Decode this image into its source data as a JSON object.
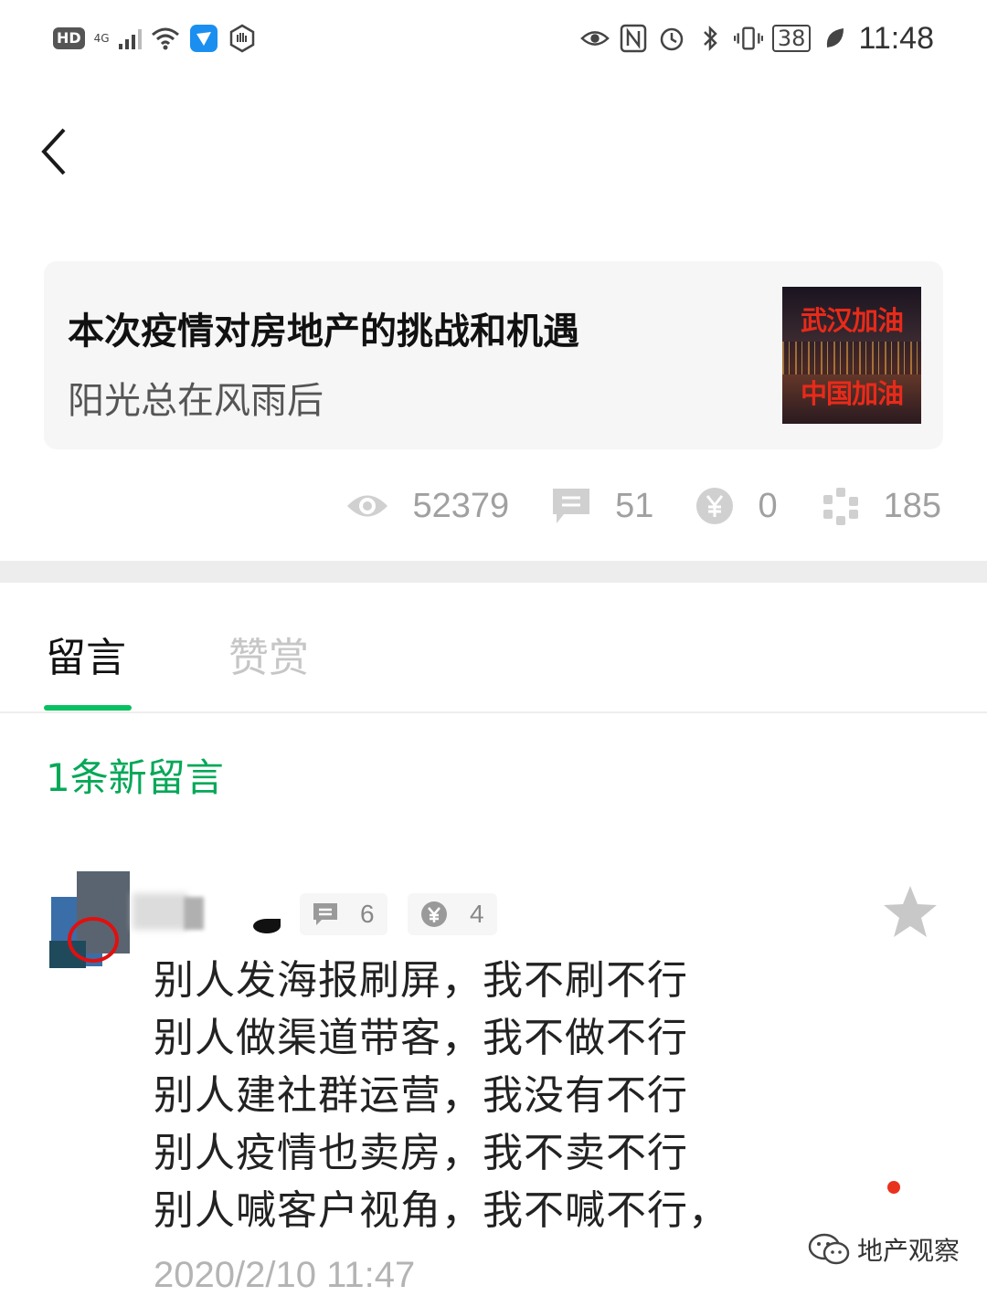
{
  "status_bar": {
    "left_badge": "HD",
    "network": "4G",
    "battery": "38",
    "time": "11:48"
  },
  "article": {
    "title": "本次疫情对房地产的挑战和机遇",
    "author": "阳光总在风雨后",
    "thumbnail_text_top": "武汉加油",
    "thumbnail_text_bottom": "中国加油"
  },
  "stats": {
    "views": "52379",
    "comments": "51",
    "rewards": "0",
    "shares": "185"
  },
  "tabs": [
    {
      "label": "留言",
      "active": true
    },
    {
      "label": "赞赏",
      "active": false
    }
  ],
  "colors": {
    "accent": "#07c160",
    "new_comment_text": "#06a858",
    "dot": "#e8321e"
  },
  "new_comments_label": "1条新留言",
  "comment": {
    "reply_count": "6",
    "like_count": "4",
    "lines": [
      "别人发海报刷屏，我不刷不行",
      "别人做渠道带客，我不做不行",
      "别人建社群运营，我没有不行",
      "别人疫情也卖房，我不卖不行",
      "别人喊客户视角，我不喊不行，"
    ],
    "time": "2020/2/10 11:47"
  },
  "watermark": {
    "text": "地产观察"
  }
}
